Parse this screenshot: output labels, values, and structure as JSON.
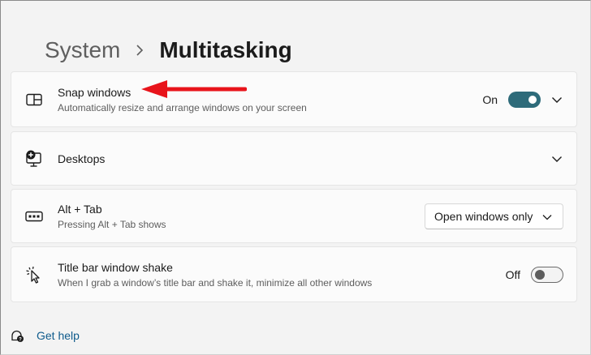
{
  "breadcrumb": {
    "parent": "System",
    "current": "Multitasking"
  },
  "cards": {
    "snap": {
      "title": "Snap windows",
      "description": "Automatically resize and arrange windows on your screen",
      "state_label": "On",
      "icon": "snap-layout-icon"
    },
    "desktops": {
      "title": "Desktops",
      "icon": "desktop-add-icon"
    },
    "alttab": {
      "title": "Alt + Tab",
      "description": "Pressing Alt + Tab shows",
      "selected": "Open windows only",
      "icon": "keyboard-icon"
    },
    "shake": {
      "title": "Title bar window shake",
      "description": "When I grab a window’s title bar and shake it, minimize all other windows",
      "state_label": "Off",
      "icon": "cursor-shake-icon"
    }
  },
  "help": {
    "label": "Get help",
    "icon": "help-chat-icon"
  },
  "colors": {
    "accent": "#2e6b7a",
    "annotation_arrow": "#e8141b",
    "link": "#0f5b8c"
  }
}
